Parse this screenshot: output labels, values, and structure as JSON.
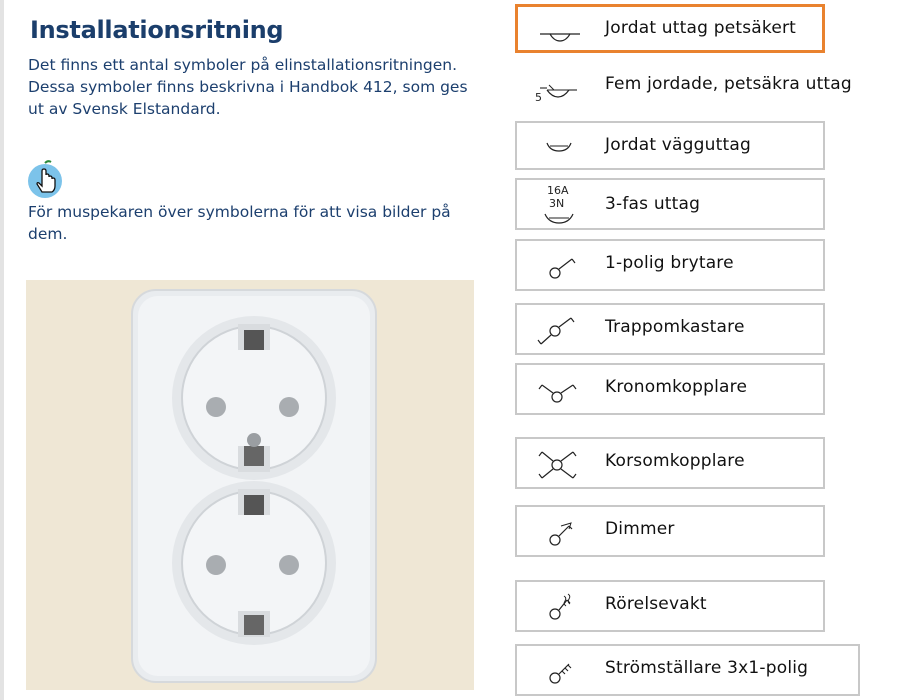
{
  "page": {
    "title": "Installationsritning",
    "intro": "Det finns ett antal symboler på elinstallationsritningen. Dessa symboler finns beskrivna i Handbok 412, som ges ut av Svensk Elstandard.",
    "hint": "För muspekaren över symbolerna för att visa bilder på dem."
  },
  "symbols": [
    {
      "label": "Jordat uttag petsäkert",
      "icon": "socket-grounded-childproof-icon",
      "active": true
    },
    {
      "label": "Fem jordade, petsäkra uttag",
      "icon": "five-socket-icon",
      "prefix": "5"
    },
    {
      "label": "Jordat vägguttag",
      "icon": "wall-socket-icon"
    },
    {
      "label": "3-fas uttag",
      "icon": "three-phase-socket-icon",
      "amp": "16A",
      "phase": "3N"
    },
    {
      "label": "1-polig brytare",
      "icon": "single-pole-switch-icon"
    },
    {
      "label": "Trappomkastare",
      "icon": "staircase-switch-icon"
    },
    {
      "label": "Kronomkopplare",
      "icon": "chandelier-switch-icon"
    },
    {
      "label": "Korsomkopplare",
      "icon": "cross-switch-icon"
    },
    {
      "label": "Dimmer",
      "icon": "dimmer-icon"
    },
    {
      "label": "Rörelsevakt",
      "icon": "motion-sensor-icon"
    },
    {
      "label": "Strömställare 3x1-polig",
      "icon": "switch-3x1-pole-icon"
    }
  ],
  "colors": {
    "title": "#1b3e6b",
    "active_border": "#e9822e",
    "item_border": "#c8c8c8",
    "photo_bg": "#efe7d5"
  }
}
